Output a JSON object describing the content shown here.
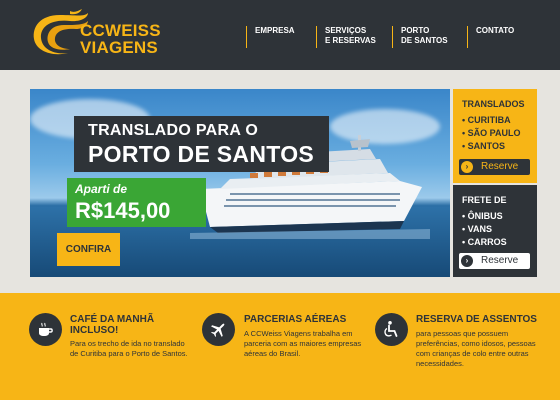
{
  "header": {
    "logo_line1": "CCWEISS",
    "logo_line2": "VIAGENS",
    "nav": [
      {
        "line1": "EMPRESA",
        "line2": ""
      },
      {
        "line1": "SERVIÇOS",
        "line2": "E RESERVAS"
      },
      {
        "line1": "PORTO",
        "line2": "DE SANTOS"
      },
      {
        "line1": "CONTATO",
        "line2": ""
      }
    ]
  },
  "hero": {
    "title_line1": "TRANSLADO PARA O",
    "title_line2": "PORTO DE SANTOS",
    "price_label": "Aparti de",
    "price_value": "R$145,00",
    "cta": "CONFIRA"
  },
  "side": {
    "translados": {
      "heading": "TRANSLADOS",
      "items": [
        "• CURITIBA",
        "• SÃO PAULO",
        "• SANTOS"
      ],
      "button": "Reserve"
    },
    "frete": {
      "heading": "FRETE DE",
      "items": [
        "• ÔNIBUS",
        "• VANS",
        "• CARROS"
      ],
      "button": "Reserve"
    }
  },
  "features": [
    {
      "icon": "coffee-cup-icon",
      "title_line1": "CAFÉ DA MANHÃ",
      "title_line2": "INCLUSO!",
      "text": [
        "Para os trecho de ida no translado",
        "de Curitiba para o Porto de Santos."
      ]
    },
    {
      "icon": "airplane-icon",
      "title_line1": "PARCERIAS AÉREAS",
      "title_line2": "",
      "text": [
        "A CCWeiss Viagens trabalha em",
        "parceria com as maiores empresas",
        "aéreas do Brasil."
      ]
    },
    {
      "icon": "accessibility-icon",
      "title_line1": "RESERVA DE ASSENTOS",
      "title_line2": "",
      "text": [
        "para pessoas que possuem",
        "preferências, como idosos, pessoas",
        "com crianças de colo entre outras",
        "necessidades."
      ]
    }
  ],
  "colors": {
    "brand_yellow": "#f7b516",
    "dark": "#2e3338",
    "price_green": "#3aa635"
  }
}
